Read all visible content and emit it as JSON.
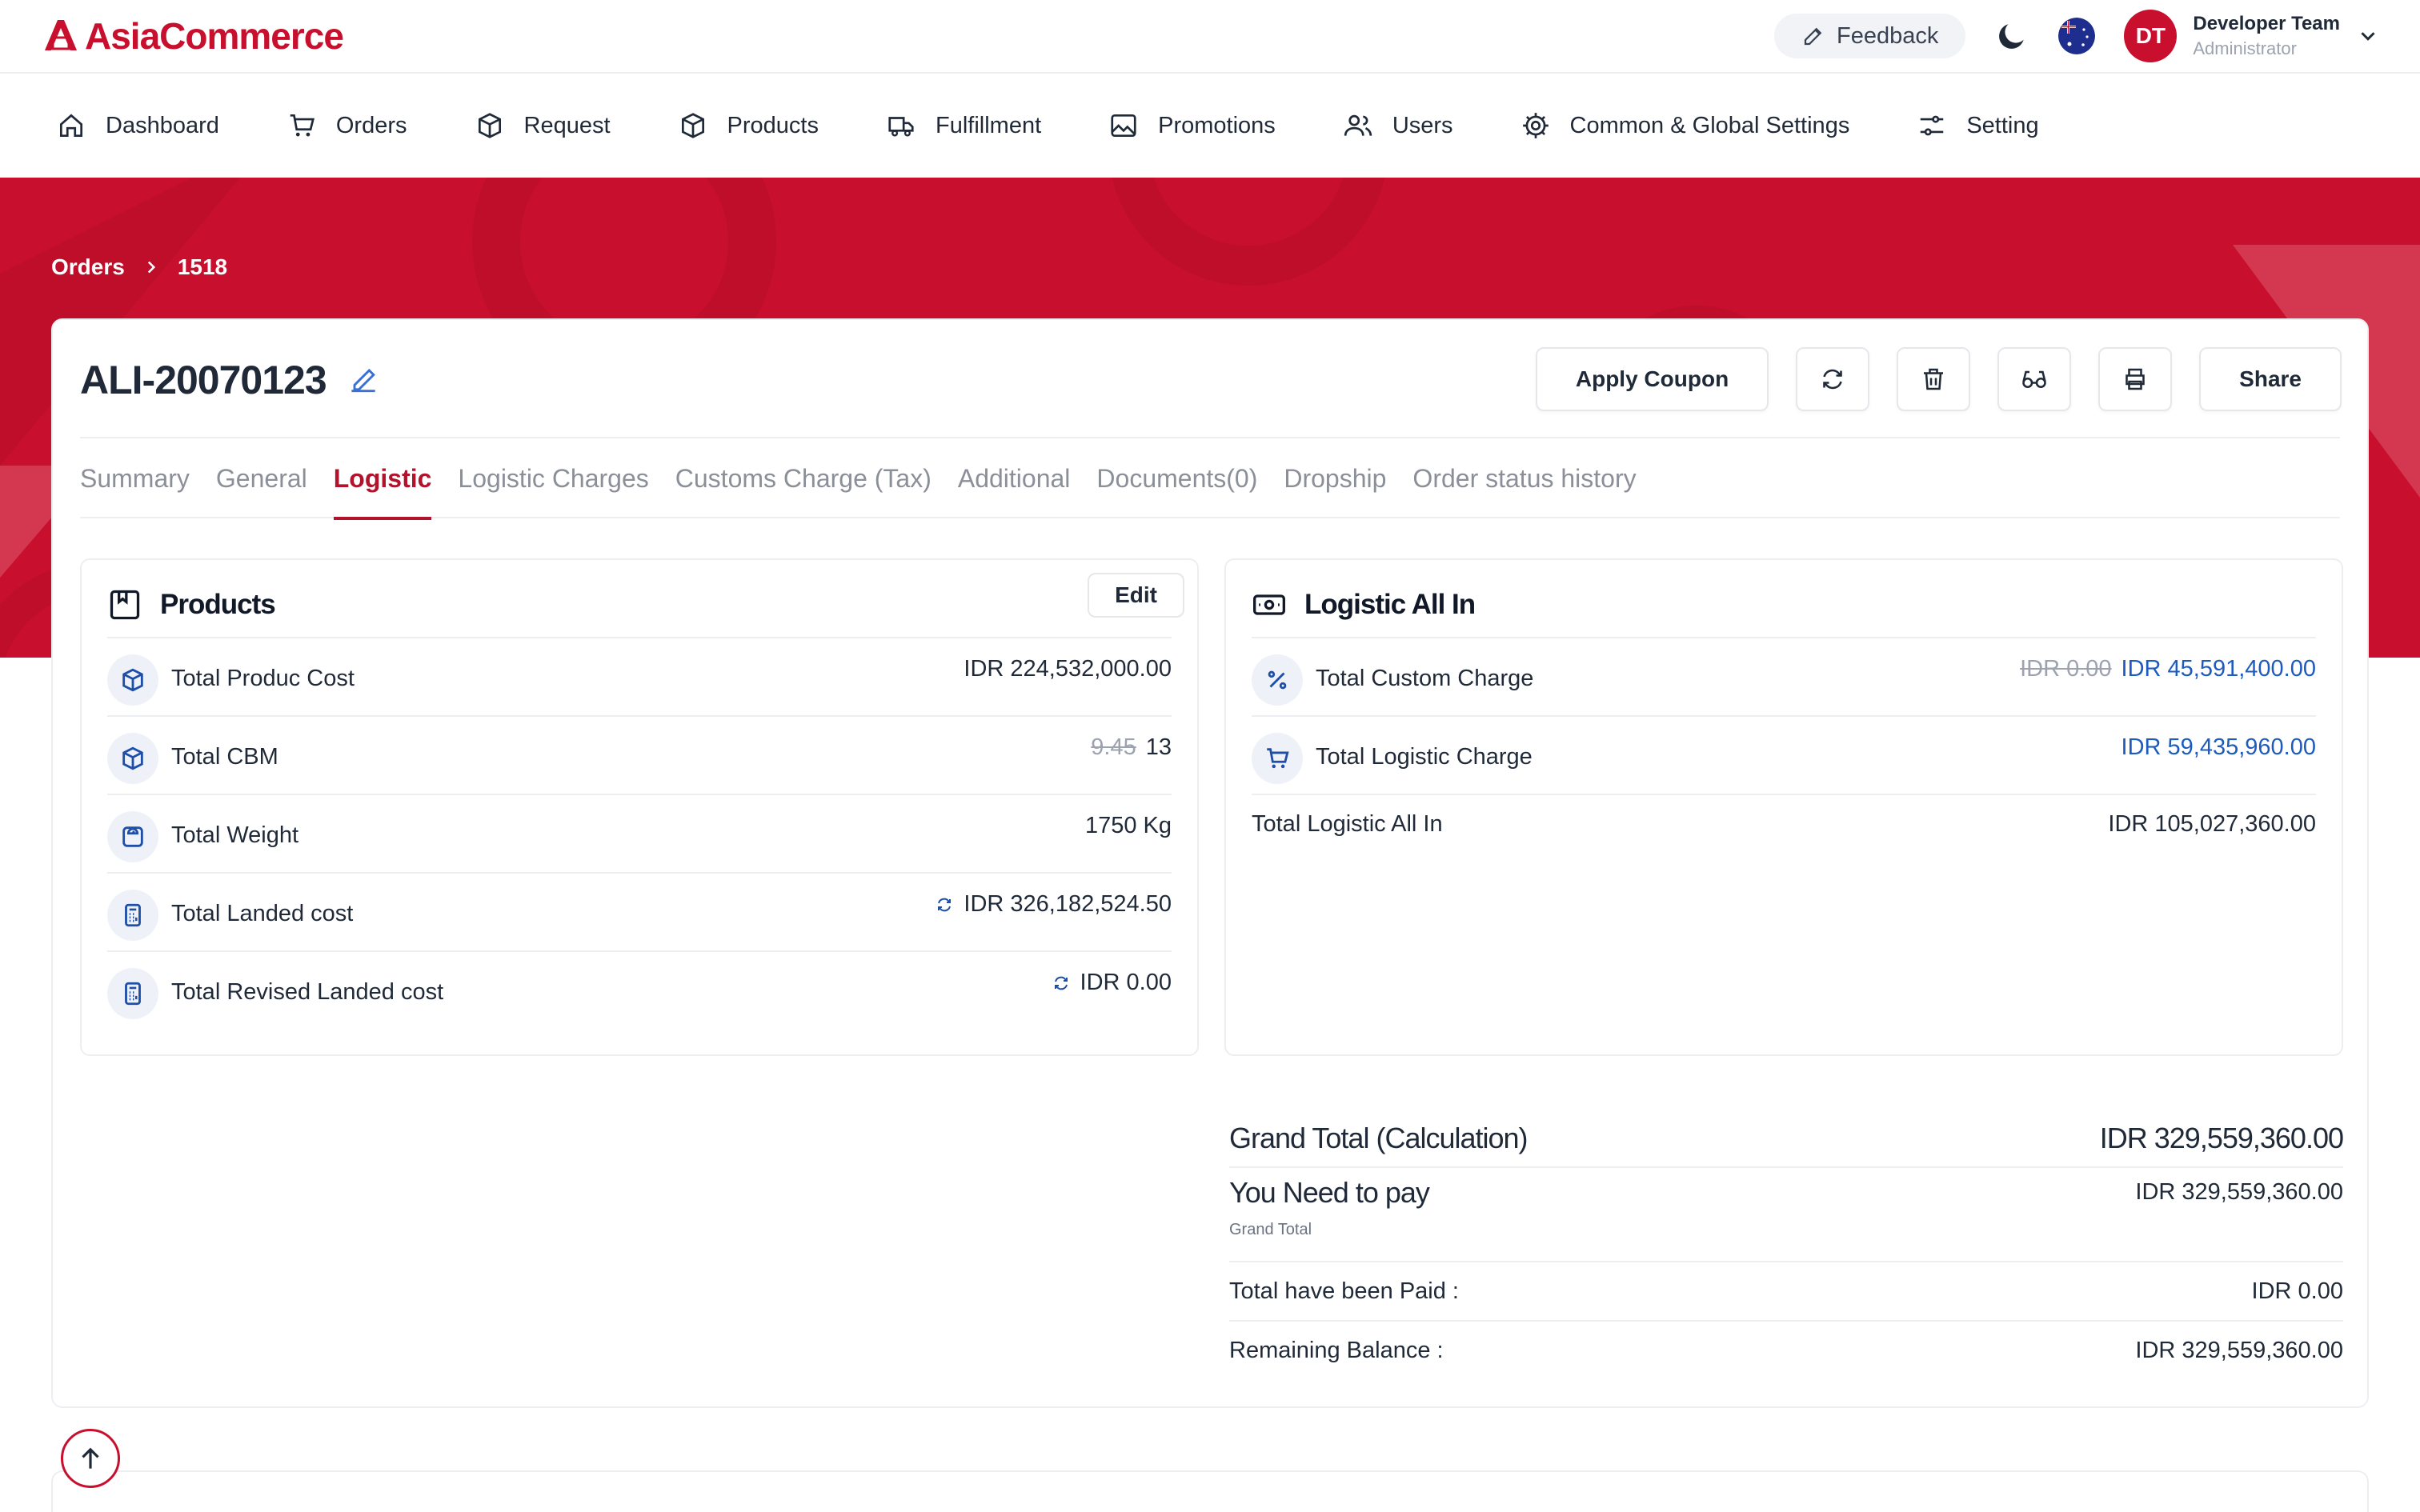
{
  "brand": {
    "name": "AsiaCommerce",
    "color": "#c8102e"
  },
  "header": {
    "feedback_label": "Feedback",
    "user": {
      "initials": "DT",
      "name": "Developer Team",
      "role": "Administrator"
    }
  },
  "nav": [
    {
      "label": "Dashboard",
      "icon": "home-icon"
    },
    {
      "label": "Orders",
      "icon": "cart-icon"
    },
    {
      "label": "Request",
      "icon": "box-icon"
    },
    {
      "label": "Products",
      "icon": "box-icon"
    },
    {
      "label": "Fulfillment",
      "icon": "truck-icon"
    },
    {
      "label": "Promotions",
      "icon": "image-icon"
    },
    {
      "label": "Users",
      "icon": "users-icon"
    },
    {
      "label": "Common & Global Settings",
      "icon": "gear-icon"
    },
    {
      "label": "Setting",
      "icon": "sliders-icon"
    }
  ],
  "breadcrumb": {
    "parent": "Orders",
    "current": "1518"
  },
  "order": {
    "id": "ALI-20070123"
  },
  "actions": {
    "apply_coupon": "Apply Coupon",
    "share": "Share"
  },
  "tabs": [
    {
      "label": "Summary",
      "active": false
    },
    {
      "label": "General",
      "active": false
    },
    {
      "label": "Logistic",
      "active": true
    },
    {
      "label": "Logistic Charges",
      "active": false
    },
    {
      "label": "Customs Charge (Tax)",
      "active": false
    },
    {
      "label": "Additional",
      "active": false
    },
    {
      "label": "Documents(0)",
      "active": false
    },
    {
      "label": "Dropship",
      "active": false
    },
    {
      "label": "Order status history",
      "active": false
    }
  ],
  "products_panel": {
    "title": "Products",
    "edit_label": "Edit",
    "rows": [
      {
        "label": "Total Produc Cost",
        "value": "IDR 224,532,000.00"
      },
      {
        "label": "Total CBM",
        "old_value": "9.45",
        "value": "13"
      },
      {
        "label": "Total Weight",
        "value": "1750 Kg"
      },
      {
        "label": "Total Landed cost",
        "value": "IDR 326,182,524.50"
      },
      {
        "label": "Total Revised Landed cost",
        "value": "IDR 0.00"
      }
    ]
  },
  "logistic_panel": {
    "title": "Logistic All In",
    "rows": [
      {
        "label": "Total Custom Charge",
        "old_value": "IDR 0.00",
        "value": "IDR 45,591,400.00"
      },
      {
        "label": "Total Logistic Charge",
        "value": "IDR 59,435,960.00"
      },
      {
        "label": "Total Logistic All In",
        "value": "IDR 105,027,360.00"
      }
    ]
  },
  "totals": {
    "grand_label": "Grand Total (Calculation)",
    "grand_value": "IDR 329,559,360.00",
    "pay_label": "You Need to pay",
    "pay_sub": "Grand Total",
    "pay_value": "IDR 329,559,360.00",
    "paid_label": "Total have been Paid :",
    "paid_value": "IDR 0.00",
    "remaining_label": "Remaining Balance :",
    "remaining_value": "IDR 329,559,360.00"
  }
}
